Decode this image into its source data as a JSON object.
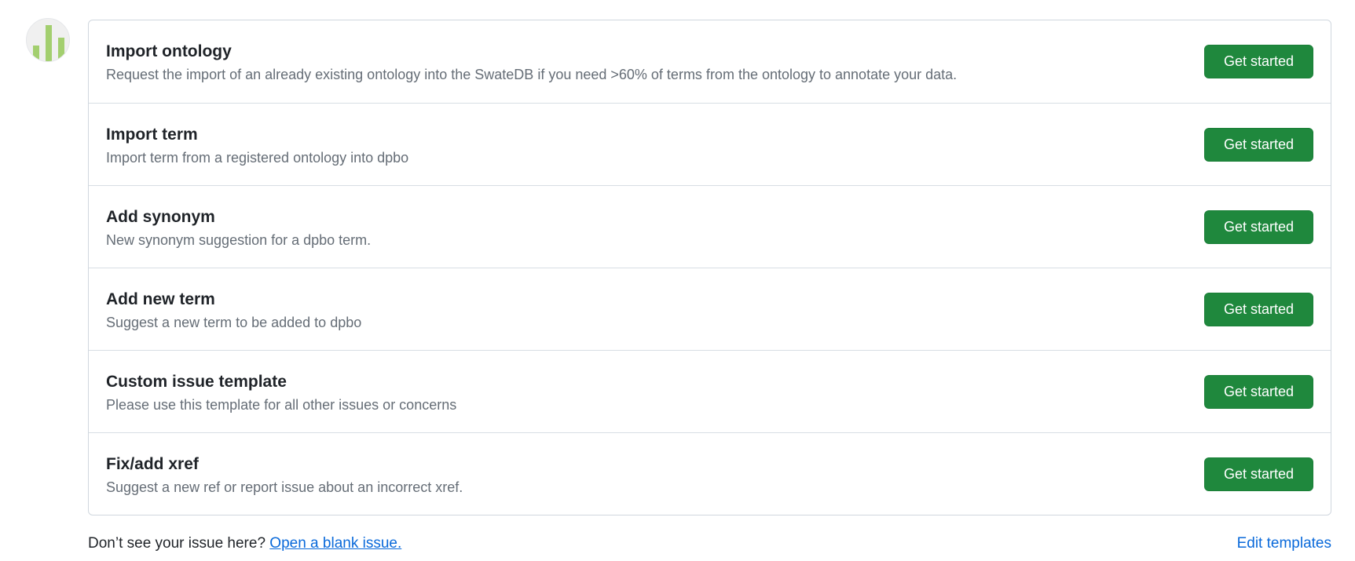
{
  "templates": [
    {
      "title": "Import ontology",
      "description": "Request the import of an already existing ontology into the SwateDB if you need >60% of terms from the ontology to annotate your data.",
      "button": "Get started"
    },
    {
      "title": "Import term",
      "description": "Import term from a registered ontology into dpbo",
      "button": "Get started"
    },
    {
      "title": "Add synonym",
      "description": "New synonym suggestion for a dpbo term.",
      "button": "Get started"
    },
    {
      "title": "Add new term",
      "description": "Suggest a new term to be added to dpbo",
      "button": "Get started"
    },
    {
      "title": "Custom issue template",
      "description": "Please use this template for all other issues or concerns",
      "button": "Get started"
    },
    {
      "title": "Fix/add xref",
      "description": "Suggest a new ref or report issue about an incorrect xref.",
      "button": "Get started"
    }
  ],
  "footer": {
    "prompt": "Don’t see your issue here?",
    "blank_issue_link": "Open a blank issue.",
    "edit_templates_link": "Edit templates"
  },
  "colors": {
    "primary_button": "#1f883d",
    "link": "#0969da",
    "avatar_bars": "#a3cf6f"
  }
}
